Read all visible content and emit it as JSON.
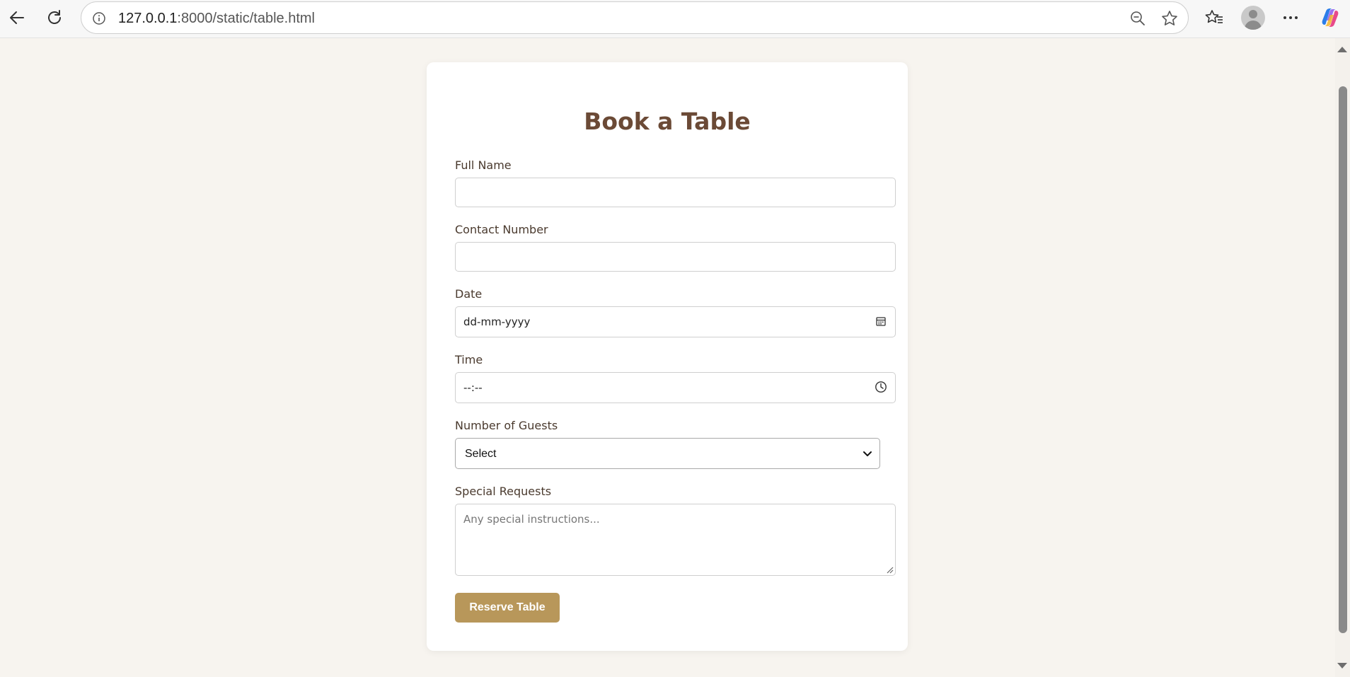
{
  "browser": {
    "url_host": "127.0.0.1",
    "url_path": ":8000/static/table.html"
  },
  "form": {
    "title": "Book a Table",
    "full_name_label": "Full Name",
    "contact_label": "Contact Number",
    "date_label": "Date",
    "date_placeholder": "dd-mm-yyyy",
    "time_label": "Time",
    "time_placeholder": "--:--",
    "guests_label": "Number of Guests",
    "guests_selected": "Select",
    "requests_label": "Special Requests",
    "requests_placeholder": "Any special instructions...",
    "submit_label": "Reserve Table"
  },
  "colors": {
    "title": "#6b4a36",
    "button": "#b8975a",
    "page_bg": "#f7f4ef"
  }
}
